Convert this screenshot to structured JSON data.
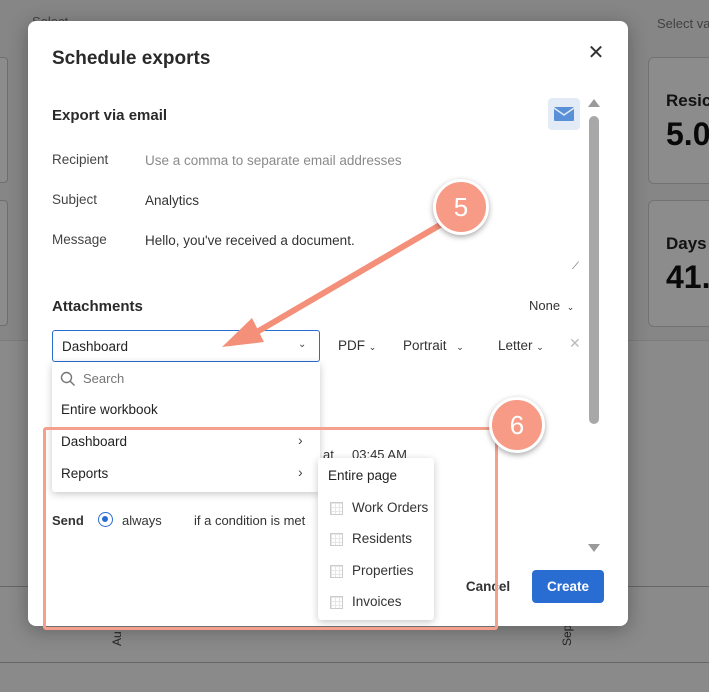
{
  "background": {
    "top_left_text": "Select…",
    "top_right_text": "Select va",
    "cards": [
      {
        "label": "Resic",
        "value": "5.0"
      },
      {
        "label": "Days",
        "value": "41."
      }
    ],
    "axis_text_left": "Au",
    "axis_text_right": "Sep"
  },
  "dialog": {
    "title": "Schedule exports",
    "close_icon": "close-icon",
    "email_section_title": "Export via email",
    "email_icon": "envelope-icon",
    "recipient": {
      "label": "Recipient",
      "placeholder": "Use a comma to separate email addresses"
    },
    "subject": {
      "label": "Subject",
      "value": "Analytics"
    },
    "message": {
      "label": "Message",
      "value": "Hello, you've received a document."
    },
    "attachments": {
      "title": "Attachments",
      "none_dropdown": "None",
      "selected": "Dashboard",
      "format": "PDF",
      "orientation": "Portrait",
      "paper_size": "Letter"
    },
    "schedule": {
      "at_label": "at",
      "time": "03:45 AM"
    },
    "send": {
      "label": "Send",
      "options": [
        {
          "label": "always",
          "selected": true
        },
        {
          "label": "if a condition is met",
          "selected": false
        }
      ]
    },
    "buttons": {
      "cancel": "Cancel",
      "create": "Create"
    },
    "accent_color": "#2a6dd2"
  },
  "dropdown": {
    "search_placeholder": "Search",
    "items": [
      {
        "label": "Entire workbook",
        "has_submenu": false
      },
      {
        "label": "Dashboard",
        "has_submenu": true
      },
      {
        "label": "Reports",
        "has_submenu": true
      }
    ]
  },
  "submenu": {
    "entire_page": "Entire page",
    "items": [
      "Work Orders",
      "Residents",
      "Properties",
      "Invoices"
    ]
  },
  "annotations": {
    "badge_5": "5",
    "badge_6": "6",
    "color": "#f79a86"
  }
}
